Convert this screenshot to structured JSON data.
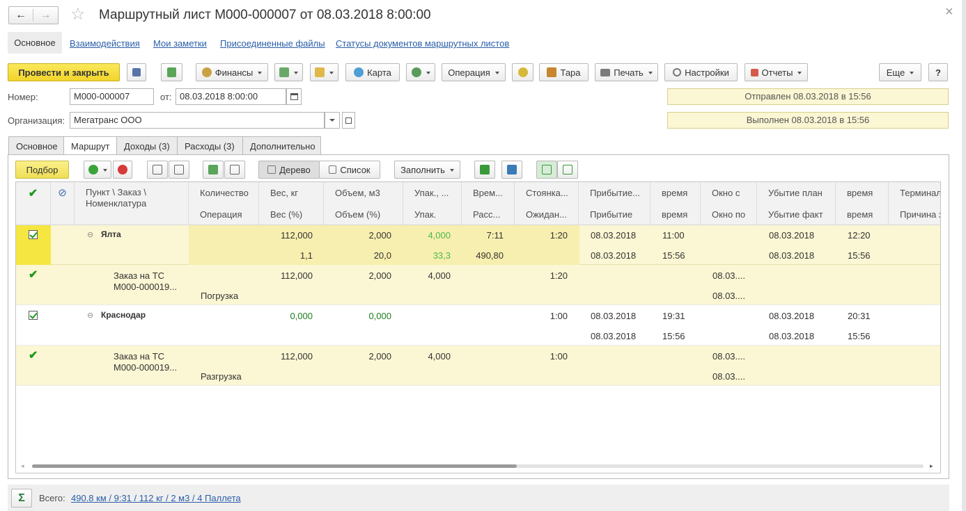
{
  "window": {
    "title": "Маршрутный лист М000-000007 от 08.03.2018 8:00:00",
    "back": "←",
    "forward": "→",
    "star": "☆",
    "close": "×"
  },
  "nav": {
    "main": "Основное",
    "links": [
      "Взаимодействия",
      "Мои заметки",
      "Присоединенные файлы",
      "Статусы документов маршрутных листов"
    ]
  },
  "toolbar": {
    "post_close": "Провести и закрыть",
    "finance": "Финансы",
    "map": "Карта",
    "operation": "Операция",
    "tare": "Тара",
    "print": "Печать",
    "settings": "Настройки",
    "reports": "Отчеты",
    "more": "Еще",
    "help": "?"
  },
  "form": {
    "number_label": "Номер:",
    "number": "М000-000007",
    "from_label": "от:",
    "date": "08.03.2018  8:00:00",
    "org_label": "Организация:",
    "org": "Мегатранс ООО",
    "status_sent": "Отправлен 08.03.2018 в 15:56",
    "status_done": "Выполнен 08.03.2018 в 15:56"
  },
  "tabs": [
    "Основное",
    "Маршрут",
    "Доходы (3)",
    "Расходы (3)",
    "Дополнительно"
  ],
  "subbar": {
    "pick": "Подбор",
    "tree": "Дерево",
    "list": "Список",
    "fill": "Заполнить"
  },
  "columns": {
    "top": [
      "Пункт \\ Заказ \\",
      "Количество",
      "Вес, кг",
      "Объем, м3",
      "Упак., ...",
      "Врем...",
      "Стоянка...",
      "Прибытие...",
      "время",
      "Окно с",
      "Убытие план",
      "время",
      "Терминал"
    ],
    "second": "Номенклатура",
    "bottom": [
      "Операция",
      "Вес (%)",
      "Объем (%)",
      "Упак.",
      "Расс...",
      "Ожидан...",
      "Прибытие",
      "время",
      "Окно по",
      "Убытие факт",
      "время",
      "Причина з"
    ]
  },
  "rows": [
    {
      "name": "Ялта",
      "weight": "112,000",
      "volume": "2,000",
      "pack": "4,000",
      "time": "7:11",
      "stop": "1:20",
      "arr": "08.03.2018",
      "arr_t": "11:00",
      "dep": "08.03.2018",
      "dep_t": "12:20",
      "weight_pct": "1,1",
      "volume_pct": "20,0",
      "pack_pct": "33,3",
      "dist": "490,80",
      "arr2": "08.03.2018",
      "arr2_t": "15:56",
      "dep2": "08.03.2018",
      "dep2_t": "15:56"
    },
    {
      "name": "Заказ на ТС",
      "name2": "М000-000019...",
      "op": "Погрузка",
      "weight": "112,000",
      "volume": "2,000",
      "pack": "4,000",
      "stop": "1:20",
      "win_from": "08.03....",
      "win_to": "08.03...."
    },
    {
      "name": "Краснодар",
      "weight": "0,000",
      "volume": "0,000",
      "stop": "1:00",
      "arr": "08.03.2018",
      "arr_t": "19:31",
      "dep": "08.03.2018",
      "dep_t": "20:31",
      "arr2": "08.03.2018",
      "arr2_t": "15:56",
      "dep2": "08.03.2018",
      "dep2_t": "15:56"
    },
    {
      "name": "Заказ на ТС",
      "name2": "М000-000019...",
      "op": "Разгрузка",
      "weight": "112,000",
      "volume": "2,000",
      "pack": "4,000",
      "stop": "1:00",
      "win_from": "08.03....",
      "win_to": "08.03...."
    }
  ],
  "footer": {
    "sigma": "Σ",
    "total_label": "Всего:",
    "total": "490.8 км / 9:31 / 112 кг / 2 м3 / 4 Паллета"
  },
  "colors": {
    "accent": "#f5e642",
    "row_highlight": "#fbf6d3",
    "link": "#2a5ea8"
  }
}
